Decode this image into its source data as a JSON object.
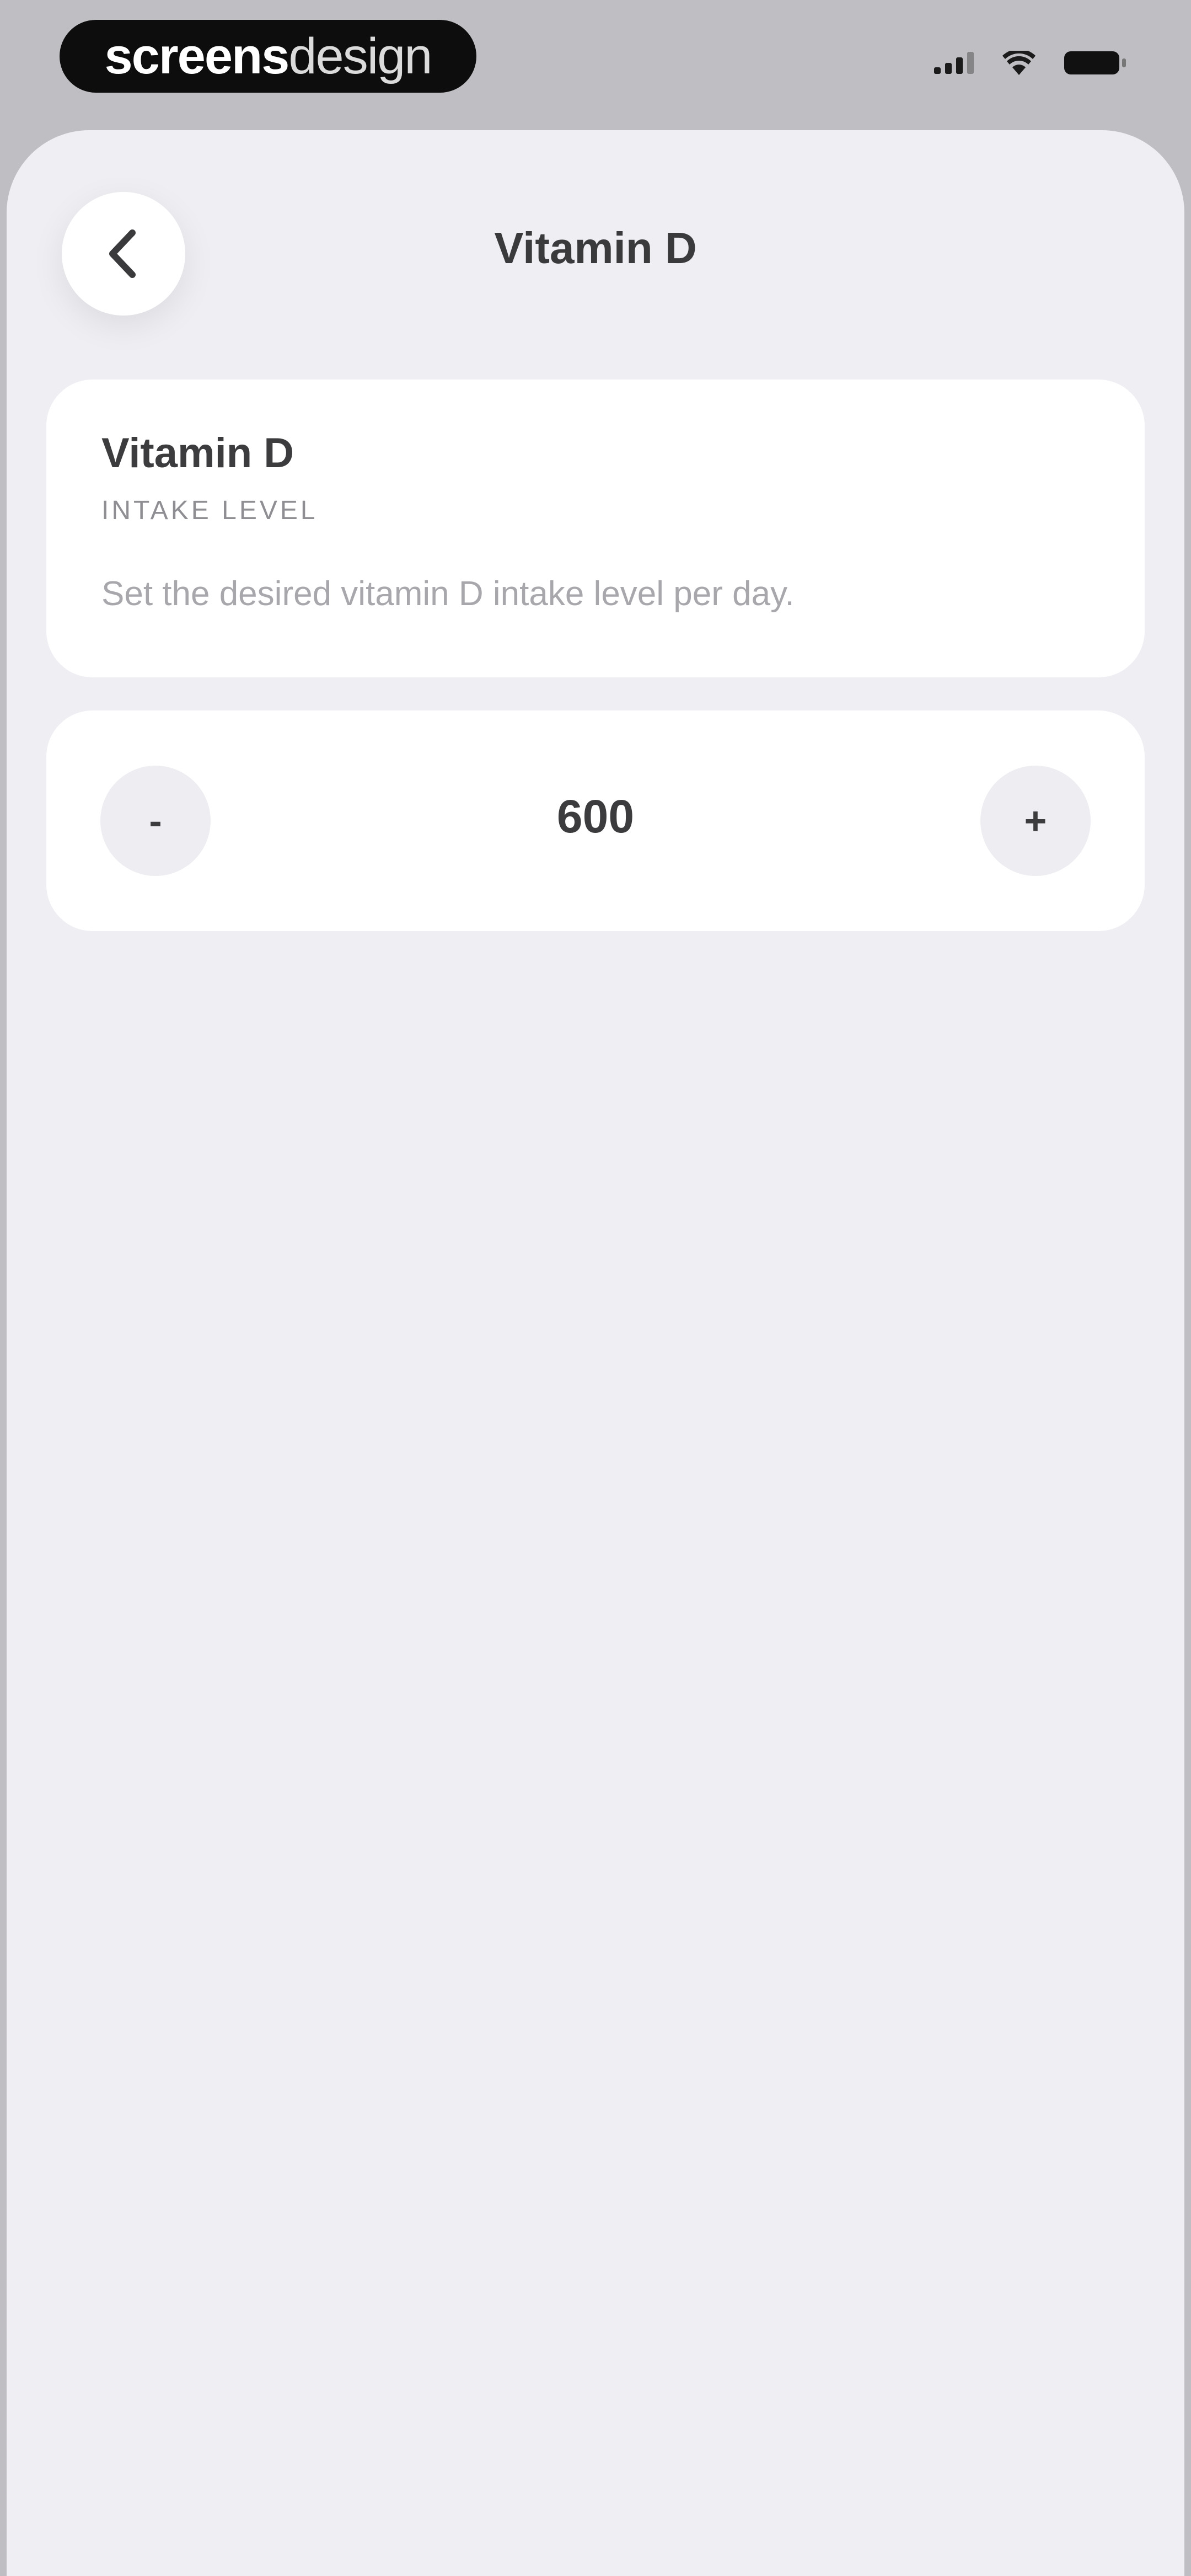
{
  "status_bar": {
    "brand": {
      "bold": "screens",
      "light": "design"
    },
    "icons": [
      "signal-icon",
      "wifi-icon",
      "battery-icon"
    ]
  },
  "nav": {
    "title": "Vitamin D",
    "back_icon": "chevron-left-icon"
  },
  "info_card": {
    "title": "Vitamin D",
    "subtitle": "INTAKE LEVEL",
    "description": "Set the desired vitamin D intake level per day."
  },
  "stepper": {
    "decrement_label": "-",
    "value": "600",
    "increment_label": "+"
  },
  "colors": {
    "background": "#efeef3",
    "card": "#ffffff",
    "text_primary": "#3c3c3e",
    "text_secondary": "#8e8e93"
  }
}
